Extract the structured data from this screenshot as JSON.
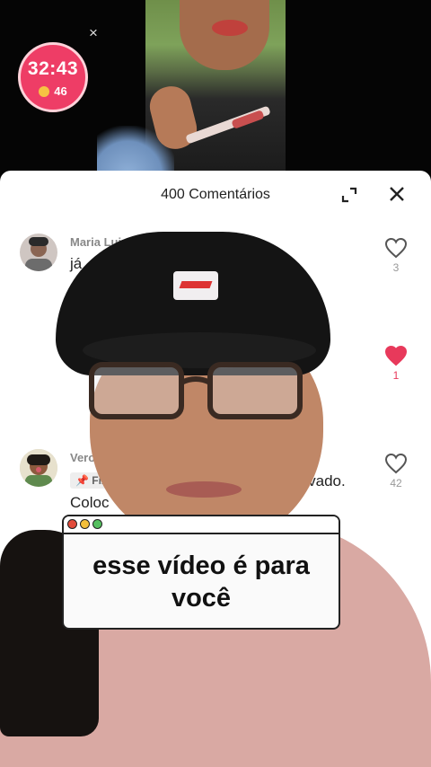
{
  "timer": {
    "time": "32:43",
    "coins": "46"
  },
  "top_close_label": "×",
  "sheet": {
    "title": "400 Comentários"
  },
  "comments": [
    {
      "name": "Maria Luiz",
      "text": "já",
      "likes": "3",
      "liked": false
    },
    {
      "likes": "1",
      "liked": true
    },
    {
      "name": "Vero",
      "pin": "Fix",
      "text_tail": "ravado.",
      "text2": "Coloc",
      "text2_tail": "!",
      "likes": "42",
      "liked": false
    }
  ],
  "caption": {
    "text_line1": "esse vídeo é para",
    "text_line2": "você"
  },
  "colors": {
    "accent": "#ee3d66",
    "heart": "#e8395b"
  },
  "icons": [
    "coin-icon",
    "close-icon",
    "expand-icon",
    "heart-icon",
    "pin-icon"
  ]
}
